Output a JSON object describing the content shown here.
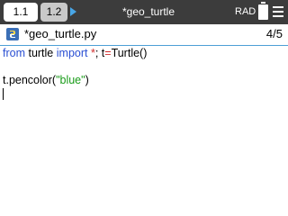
{
  "tabs": [
    {
      "label": "1.1",
      "active": true
    },
    {
      "label": "1.2",
      "active": false
    }
  ],
  "title_bar": {
    "document_title": "*geo_turtle",
    "angle_mode": "RAD",
    "battery_icon": "battery-icon",
    "menu_icon": "menu-icon"
  },
  "editor": {
    "file_name": "*geo_turtle.py",
    "page_indicator": "4/5",
    "icon": "python-file-icon"
  },
  "code": {
    "line1": {
      "kw_from": "from",
      "module": " turtle ",
      "kw_import": "import",
      "star": " *",
      "rest": "; t",
      "eq": "=",
      "call": "Turtle()"
    },
    "line3": {
      "prefix": "t.pencolor(",
      "string": "\"blue\"",
      "suffix": ")"
    }
  },
  "colors": {
    "topbar": "#3c3c3c",
    "accent_arrow": "#48a6e6",
    "keyword": "#2a4fd3",
    "operator": "#d12c2c",
    "string": "#1a9c1a"
  }
}
